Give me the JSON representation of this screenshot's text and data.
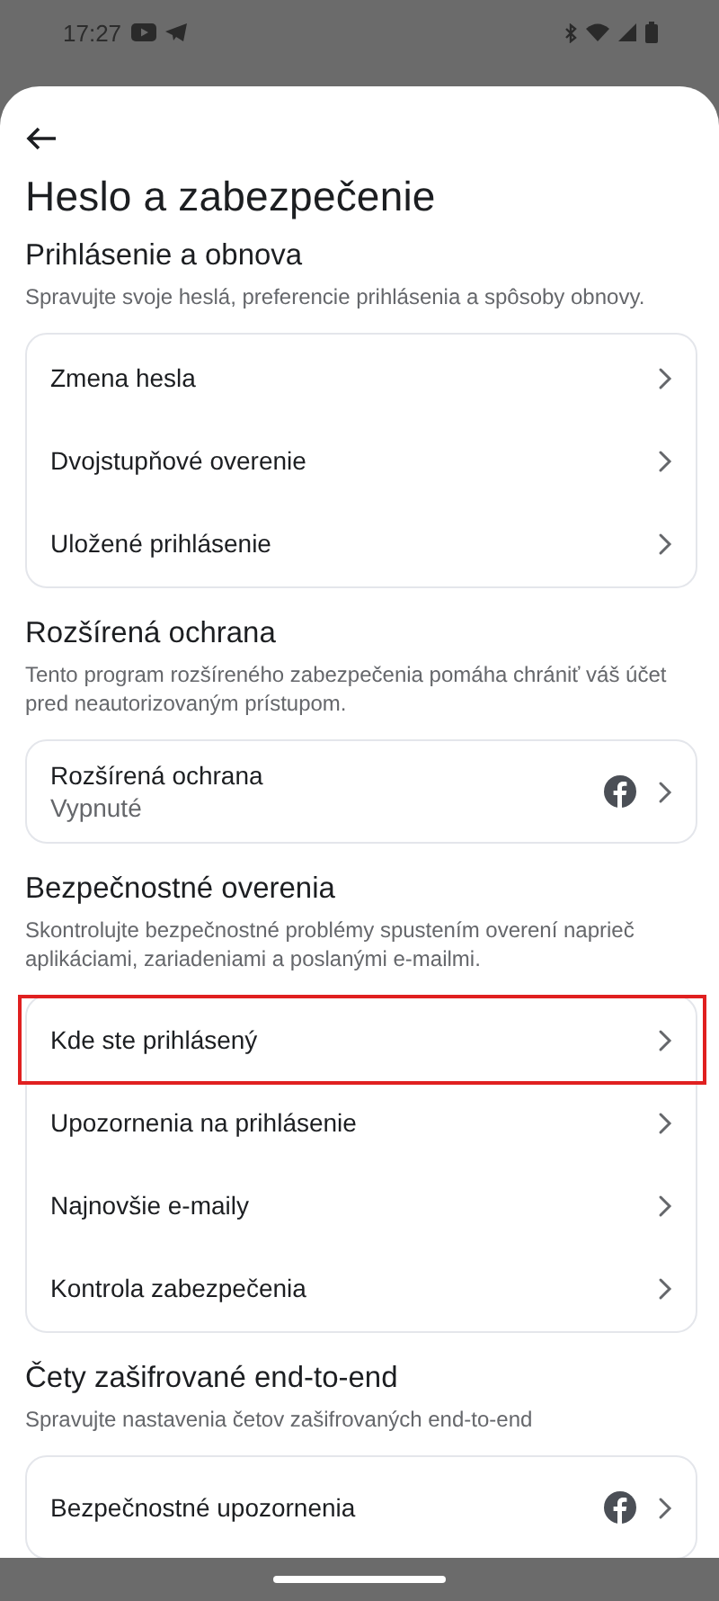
{
  "status_bar": {
    "time": "17:27"
  },
  "title": "Heslo a zabezpečenie",
  "sections": [
    {
      "heading": "Prihlásenie a obnova",
      "description": "Spravujte svoje heslá, preferencie prihlásenia a spôsoby obnovy.",
      "items": [
        {
          "kind": "plain",
          "label": "Zmena hesla",
          "selected": false
        },
        {
          "kind": "plain",
          "label": "Dvojstupňové overenie",
          "selected": false
        },
        {
          "kind": "plain",
          "label": "Uložené prihlásenie",
          "selected": false
        }
      ]
    },
    {
      "heading": "Rozšírená ochrana",
      "description": "Tento program rozšíreného zabezpečenia pomáha chrániť váš účet pred neautorizovaným prístupom.",
      "items": [
        {
          "kind": "account",
          "label": "Rozšírená ochrana",
          "value": "Vypnuté",
          "selected": false
        }
      ]
    },
    {
      "heading": "Bezpečnostné overenia",
      "description": "Skontrolujte bezpečnostné problémy spustením overení naprieč aplikáciami, zariadeniami a poslanými e-mailmi.",
      "items": [
        {
          "kind": "plain",
          "label": "Kde ste prihlásený",
          "selected": true
        },
        {
          "kind": "plain",
          "label": "Upozornenia na prihlásenie",
          "selected": false
        },
        {
          "kind": "plain",
          "label": "Najnovšie e-maily",
          "selected": false
        },
        {
          "kind": "plain",
          "label": "Kontrola zabezpečenia",
          "selected": false
        }
      ]
    },
    {
      "heading": "Čety zašifrované end-to-end",
      "description": "Spravujte nastavenia četov zašifrovaných end-to-end",
      "items": [
        {
          "kind": "account",
          "label": "Bezpečnostné upozornenia",
          "selected": false
        }
      ]
    }
  ]
}
